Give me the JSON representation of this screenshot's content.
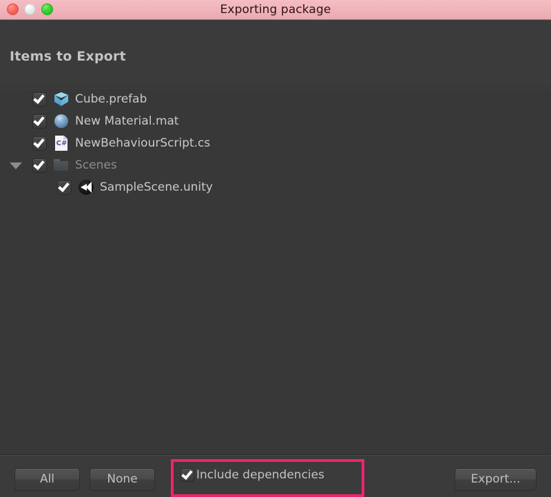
{
  "window": {
    "title": "Exporting package",
    "traffic_lights": [
      {
        "name": "close",
        "color": "#fb6055"
      },
      {
        "name": "minimize",
        "color": "#e7e7e7"
      },
      {
        "name": "maximize",
        "color": "#2fcf2a"
      }
    ],
    "titlebar_color": "#f0b4ba"
  },
  "header": {
    "title": "Items to Export"
  },
  "list": {
    "items": [
      {
        "label": "Cube.prefab",
        "icon": "prefab-cube-icon",
        "checked": true,
        "indent": 0,
        "foldout": "",
        "dimmed": false
      },
      {
        "label": "New Material.mat",
        "icon": "material-sphere-icon",
        "checked": true,
        "indent": 0,
        "foldout": "",
        "dimmed": false
      },
      {
        "label": "NewBehaviourScript.cs",
        "icon": "csharp-script-icon",
        "checked": true,
        "indent": 0,
        "foldout": "",
        "dimmed": false
      },
      {
        "label": "Scenes",
        "icon": "folder-icon",
        "checked": true,
        "indent": 0,
        "foldout": "expanded",
        "dimmed": true
      },
      {
        "label": "SampleScene.unity",
        "icon": "unity-scene-icon",
        "checked": true,
        "indent": 1,
        "foldout": "",
        "dimmed": false
      }
    ]
  },
  "bottom": {
    "all_label": "All",
    "none_label": "None",
    "include_dependencies_label": "Include dependencies",
    "include_dependencies_checked": true,
    "export_label": "Export...",
    "highlight_color": "#f0226e"
  }
}
